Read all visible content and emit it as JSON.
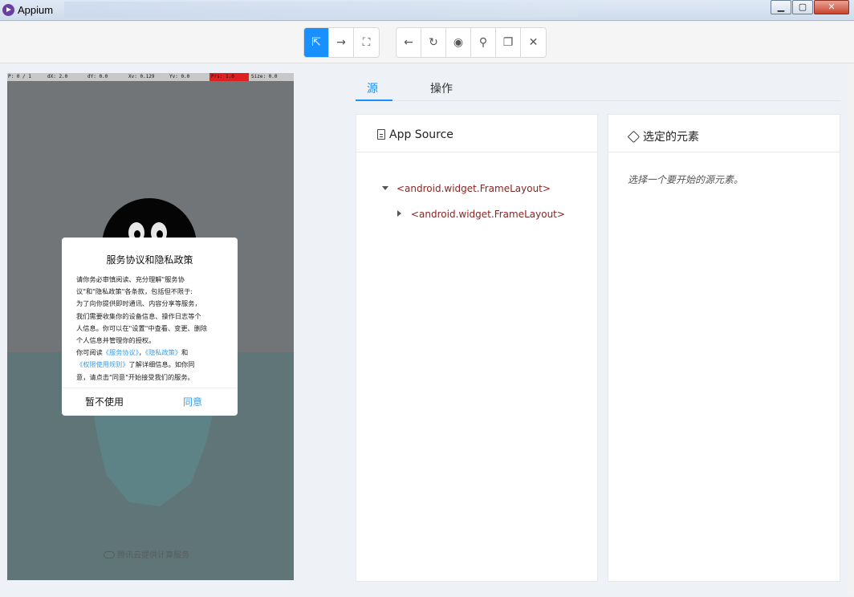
{
  "window": {
    "title": "Appium"
  },
  "toolbar": {
    "mode_buttons": [
      {
        "icon": "select-element-icon",
        "glyph": "⇱",
        "active": true
      },
      {
        "icon": "swipe-icon",
        "glyph": "→",
        "active": false
      },
      {
        "icon": "tap-coordinates-icon",
        "glyph": "⛶",
        "active": false
      }
    ],
    "action_buttons": [
      {
        "icon": "back-icon",
        "glyph": "←"
      },
      {
        "icon": "refresh-icon",
        "glyph": "↻"
      },
      {
        "icon": "eye-icon",
        "glyph": "◉"
      },
      {
        "icon": "search-icon",
        "glyph": "⚲"
      },
      {
        "icon": "copy-icon",
        "glyph": "❐"
      },
      {
        "icon": "close-icon",
        "glyph": "✕"
      }
    ]
  },
  "device": {
    "statusbar": {
      "p": "P: 0 / 1",
      "dx": "dX: 2.0",
      "dy": "dY: 0.0",
      "xv": "Xv: 0.129",
      "yv": "Yv: 0.0",
      "prs": "Prs: 1.0",
      "size": "Size: 0.0"
    },
    "dialog": {
      "title": "服务协议和隐私政策",
      "body_lines": [
        "请你务必审慎阅读、充分理解\"服务协",
        "议\"和\"隐私政策\"各条款，包括但不限于:",
        "为了向你提供即时通讯、内容分享等服务，",
        "我们需要收集你的设备信息、操作日志等个",
        "人信息。你可以在\"设置\"中查看、变更、删除",
        "个人信息并管理你的授权。"
      ],
      "line7_prefix": "你可阅读",
      "link_service": "《服务协议》",
      "line7_sep": "，",
      "link_privacy": "《隐私政策》",
      "line7_suffix": "和",
      "link_permission": "《权限使用规则》",
      "line8_suffix": "了解详细信息。如你同",
      "line9": "意，请点击\"同意\"开始接受我们的服务。",
      "decline_label": "暂不使用",
      "accept_label": "同意"
    },
    "footer": "腾讯云提供计算服务"
  },
  "tabs": [
    {
      "label": "源",
      "active": true
    },
    {
      "label": "操作",
      "active": false
    }
  ],
  "source_panel": {
    "title": "App Source",
    "tree": [
      {
        "label": "<android.widget.FrameLayout>",
        "expanded": true,
        "depth": 0
      },
      {
        "label": "<android.widget.FrameLayout>",
        "expanded": false,
        "depth": 1
      }
    ]
  },
  "selected_panel": {
    "title": "选定的元素",
    "placeholder": "选择一个要开始的源元素。"
  }
}
